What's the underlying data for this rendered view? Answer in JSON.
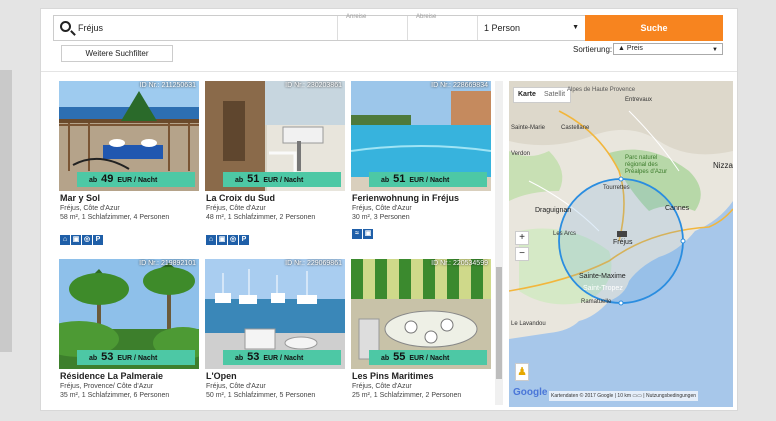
{
  "search": {
    "location_value": "Fréjus",
    "arrival_label": "Anreise",
    "departure_label": "Abreise",
    "persons_value": "1 Person",
    "search_button": "Suche",
    "filter_button": "Weitere Suchfilter",
    "sort_label": "Sortierung:",
    "sort_value": "▲ Preis"
  },
  "listings": [
    {
      "id": "ID Nr.: 211250631",
      "price_prefix": "ab",
      "price": "49",
      "price_unit": "EUR / Nacht",
      "title": "Mar y Sol",
      "region": "Fréjus, Côte d'Azur",
      "details": "58 m², 1 Schlafzimmer, 4 Personen",
      "amenity_icons": [
        "hotel-icon",
        "tv-icon",
        "washer-icon",
        "parking-icon"
      ]
    },
    {
      "id": "ID Nr.: 230203861",
      "price_prefix": "ab",
      "price": "51",
      "price_unit": "EUR / Nacht",
      "title": "La Croix du Sud",
      "region": "Fréjus, Côte d'Azur",
      "details": "48 m², 1 Schlafzimmer, 2 Personen",
      "amenity_icons": [
        "hotel-icon",
        "tv-icon",
        "washer-icon",
        "parking-icon"
      ]
    },
    {
      "id": "ID Nr.: 228669834",
      "price_prefix": "ab",
      "price": "51",
      "price_unit": "EUR / Nacht",
      "title": "Ferienwohnung in Fréjus",
      "region": "Fréjus, Côte d'Azur",
      "details": "30 m², 3 Personen",
      "amenity_icons": [
        "pool-icon",
        "tv-icon"
      ]
    },
    {
      "id": "ID Nr.: 219892101",
      "price_prefix": "ab",
      "price": "53",
      "price_unit": "EUR / Nacht",
      "title": "Résidence La Palmeraie",
      "region": "Fréjus, Provence/ Côte d'Azur",
      "details": "35 m², 1 Schlafzimmer, 6 Personen",
      "amenity_icons": []
    },
    {
      "id": "ID Nr.: 229069861",
      "price_prefix": "ab",
      "price": "53",
      "price_unit": "EUR / Nacht",
      "title": "L'Open",
      "region": "Fréjus, Côte d'Azur",
      "details": "50 m², 1 Schlafzimmer, 5 Personen",
      "amenity_icons": []
    },
    {
      "id": "ID Nr.: 220534599",
      "price_prefix": "ab",
      "price": "55",
      "price_unit": "EUR / Nacht",
      "title": "Les Pins Maritimes",
      "region": "Fréjus, Côte d'Azur",
      "details": "25 m², 1 Schlafzimmer, 2 Personen",
      "amenity_icons": []
    }
  ],
  "map": {
    "tab_map": "Karte",
    "tab_satellite": "Satellit",
    "zoom_in": "+",
    "zoom_out": "−",
    "google_logo": "Google",
    "attribution": "Kartendaten © 2017 Google",
    "scale": "10 km",
    "terms": "Nutzungsbedingungen",
    "labels": [
      {
        "text": "Alpes de Haute Provence"
      },
      {
        "text": "Entrevaux"
      },
      {
        "text": "Sainte-Marie"
      },
      {
        "text": "Castellane"
      },
      {
        "text": "Verdon"
      },
      {
        "text": "Parc naturel régional des Préalpes d'Azur"
      },
      {
        "text": "Nizza"
      },
      {
        "text": "Tourrettes"
      },
      {
        "text": "Draguignan"
      },
      {
        "text": "Cannes"
      },
      {
        "text": "Les Arcs"
      },
      {
        "text": "Fréjus"
      },
      {
        "text": "Sainte-Maxime"
      },
      {
        "text": "Saint-Tropez"
      },
      {
        "text": "Ramatuelle"
      },
      {
        "text": "Le Lavandou"
      }
    ]
  }
}
